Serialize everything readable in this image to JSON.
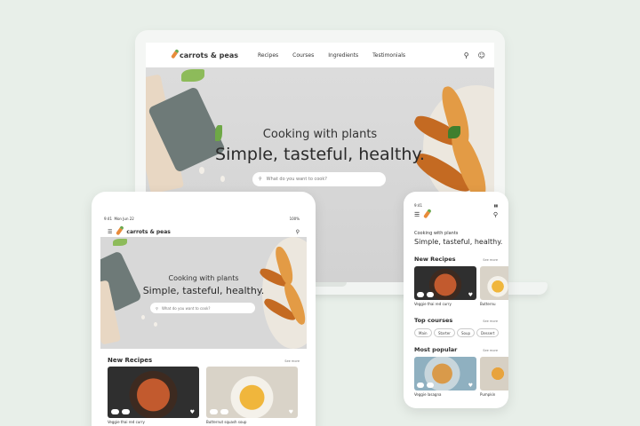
{
  "brand": {
    "name": "carrots & peas",
    "icon": "carrot-icon",
    "accent": "#e98b3a"
  },
  "laptop": {
    "nav": [
      "Recipes",
      "Courses",
      "Ingredients",
      "Testimonials"
    ],
    "hero_sub": "Cooking with plants",
    "hero_title": "Simple, tasteful, healthy.",
    "search_placeholder": "What do you want to cook?"
  },
  "tablet": {
    "time": "9:41",
    "date": "Mon Jun 22",
    "battery": "100%",
    "hero_sub": "Cooking with plants",
    "hero_title": "Simple, tasteful, healthy.",
    "search_placeholder": "What do you want to cook?",
    "section_title": "New Recipes",
    "see_more": "See more",
    "cards": [
      {
        "caption": "Veggie thai red curry"
      },
      {
        "caption": "Butternut squash soup"
      }
    ]
  },
  "phone": {
    "time": "9:41",
    "hero_sub": "Cooking with plants",
    "hero_title": "Simple, tasteful, healthy.",
    "sections": [
      {
        "title": "New Recipes",
        "see": "See more"
      },
      {
        "title": "Top courses",
        "see": "See more"
      },
      {
        "title": "Most popular",
        "see": "See more"
      }
    ],
    "new_recipes": [
      "Veggie thai red curry",
      "Butternu"
    ],
    "chips": [
      "Main",
      "Starter",
      "Soup",
      "Dessert"
    ],
    "popular": [
      "Veggie lasagna",
      "Pumpkin"
    ]
  }
}
